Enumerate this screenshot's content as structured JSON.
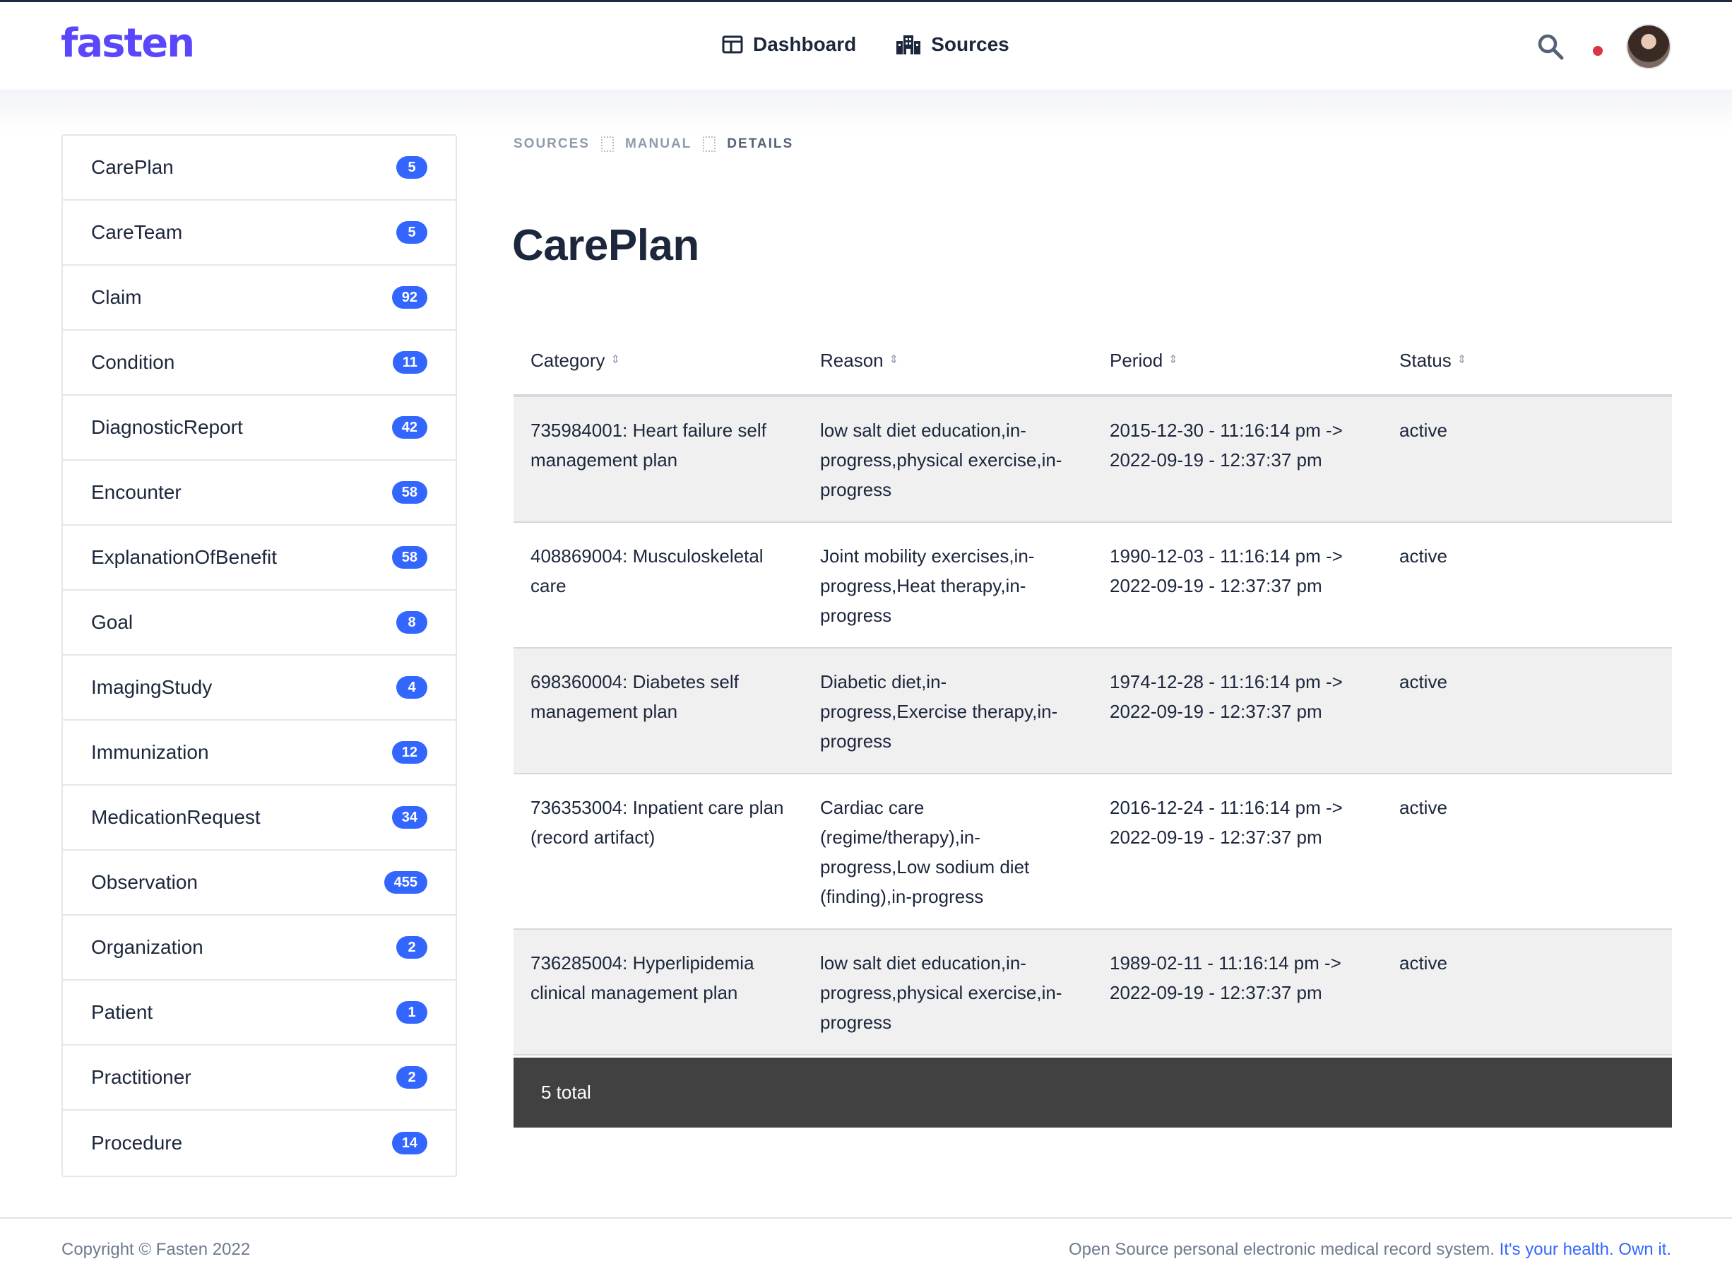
{
  "header": {
    "logo": "fasten",
    "nav": [
      {
        "label": "Dashboard",
        "icon": "dashboard-icon"
      },
      {
        "label": "Sources",
        "icon": "sources-icon"
      }
    ]
  },
  "colors": {
    "brand": "#5b47fb",
    "accent": "#3366ff",
    "badge": "#3366ff",
    "notification": "#dc3545",
    "footer_bar": "#414141"
  },
  "sidebar": {
    "items": [
      {
        "label": "CarePlan",
        "count": "5"
      },
      {
        "label": "CareTeam",
        "count": "5"
      },
      {
        "label": "Claim",
        "count": "92"
      },
      {
        "label": "Condition",
        "count": "11"
      },
      {
        "label": "DiagnosticReport",
        "count": "42"
      },
      {
        "label": "Encounter",
        "count": "58"
      },
      {
        "label": "ExplanationOfBenefit",
        "count": "58"
      },
      {
        "label": "Goal",
        "count": "8"
      },
      {
        "label": "ImagingStudy",
        "count": "4"
      },
      {
        "label": "Immunization",
        "count": "12"
      },
      {
        "label": "MedicationRequest",
        "count": "34"
      },
      {
        "label": "Observation",
        "count": "455"
      },
      {
        "label": "Organization",
        "count": "2"
      },
      {
        "label": "Patient",
        "count": "1"
      },
      {
        "label": "Practitioner",
        "count": "2"
      },
      {
        "label": "Procedure",
        "count": "14"
      }
    ]
  },
  "breadcrumb": [
    "SOURCES",
    "MANUAL",
    "DETAILS"
  ],
  "main": {
    "title": "CarePlan",
    "table": {
      "columns": [
        "Category",
        "Reason",
        "Period",
        "Status"
      ],
      "rows": [
        [
          "735984001: Heart failure self management plan",
          "low salt diet education,in-progress,physical exercise,in-progress",
          "2015-12-30 - 11:16:14 pm -> 2022-09-19 - 12:37:37 pm",
          "active"
        ],
        [
          "408869004: Musculoskeletal care",
          "Joint mobility exercises,in-progress,Heat therapy,in-progress",
          "1990-12-03 - 11:16:14 pm -> 2022-09-19 - 12:37:37 pm",
          "active"
        ],
        [
          "698360004: Diabetes self management plan",
          "Diabetic diet,in-progress,Exercise therapy,in-progress",
          "1974-12-28 - 11:16:14 pm -> 2022-09-19 - 12:37:37 pm",
          "active"
        ],
        [
          "736353004: Inpatient care plan (record artifact)",
          "Cardiac care (regime/therapy),in-progress,Low sodium diet (finding),in-progress",
          "2016-12-24 - 11:16:14 pm -> 2022-09-19 - 12:37:37 pm",
          "active"
        ],
        [
          "736285004: Hyperlipidemia clinical management plan",
          "low salt diet education,in-progress,physical exercise,in-progress",
          "1989-02-11 - 11:16:14 pm -> 2022-09-19 - 12:37:37 pm",
          "active"
        ]
      ],
      "footer": "5 total"
    }
  },
  "footer": {
    "copyright": "Copyright © Fasten 2022",
    "tagline": "Open Source personal electronic medical record system.",
    "tagline_link": "It's your health. Own it."
  }
}
